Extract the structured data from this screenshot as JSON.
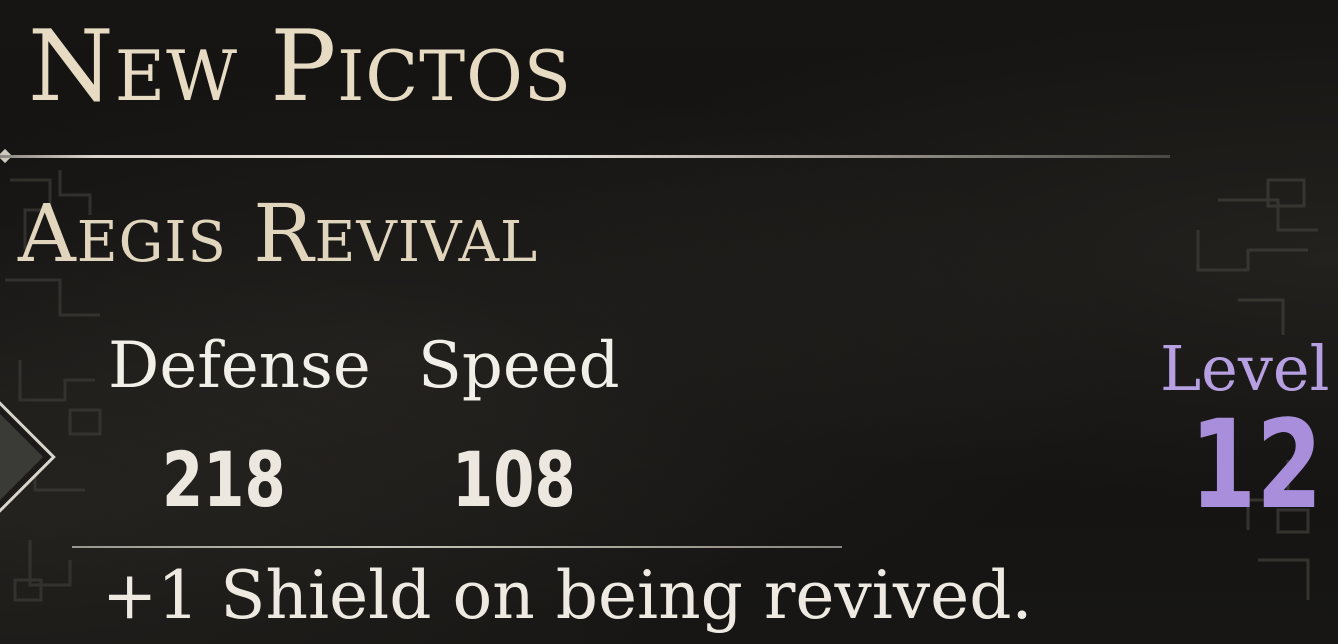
{
  "header": {
    "title": "New Pictos"
  },
  "picto": {
    "name": "Aegis Revival",
    "stats": [
      {
        "label": "Defense",
        "value": "218"
      },
      {
        "label": "Speed",
        "value": "108"
      }
    ],
    "description": "+1 Shield on being revived.",
    "level": {
      "label": "Level",
      "value": "12"
    }
  },
  "colors": {
    "title": "#e7dcc3",
    "level_accent": "#a98fdb",
    "background": "#121110"
  },
  "icons": {
    "left_marker": "diamond-arrow-icon"
  }
}
